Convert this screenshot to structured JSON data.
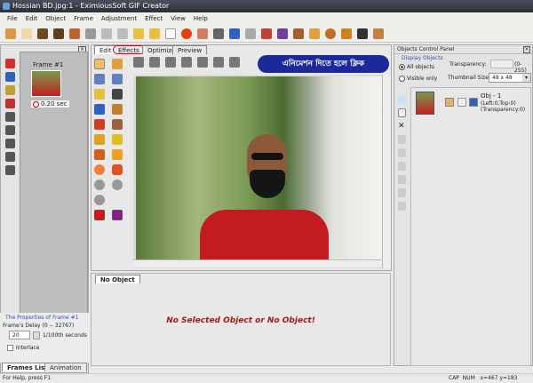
{
  "window": {
    "title": "Hossian BD.jpg:1 - EximiousSoft GIF Creator"
  },
  "menu": [
    "File",
    "Edit",
    "Object",
    "Frame",
    "Adjustment",
    "Effect",
    "View",
    "Help"
  ],
  "center_tabs": [
    "Edit",
    "Effects",
    "Optimize",
    "Preview"
  ],
  "annotation": "এনিমেশন দিতে হলে ক্লিক",
  "frames": {
    "frame_label": "Frame #1",
    "delay": "0.20 sec"
  },
  "properties": {
    "title": "The Properties of Frame #1",
    "delay_label": "Frame's Delay (0 -- 32767)",
    "delay_value": "20",
    "delay_unit": "1/100th seconds",
    "interlace": "Interlace"
  },
  "left_tabs": [
    "Frames List",
    "Animation"
  ],
  "bottom": {
    "tab": "No Object",
    "message": "No Selected Object or No Object!"
  },
  "objects_panel": {
    "title": "Objects Control Panel",
    "display_label": "Display Objects",
    "all_objects": "All objects",
    "visible_only": "Visible only",
    "transparency_label": "Transparency:",
    "transparency_range": "(0-255)",
    "thumb_label": "Thumbnail Size:",
    "thumb_value": "48 x 48",
    "obj_name": "Obj - 1",
    "obj_pos": "(Left:0,Top:0)",
    "obj_trans": "(Transparency:0)"
  },
  "status": {
    "help": "For Help, press F1",
    "indicators": "CAP  NUM   x=467 y=183"
  },
  "colors": {
    "primary": "#e01010",
    "secondary": "#8a1a9a",
    "accent": "#1b2a9a"
  }
}
